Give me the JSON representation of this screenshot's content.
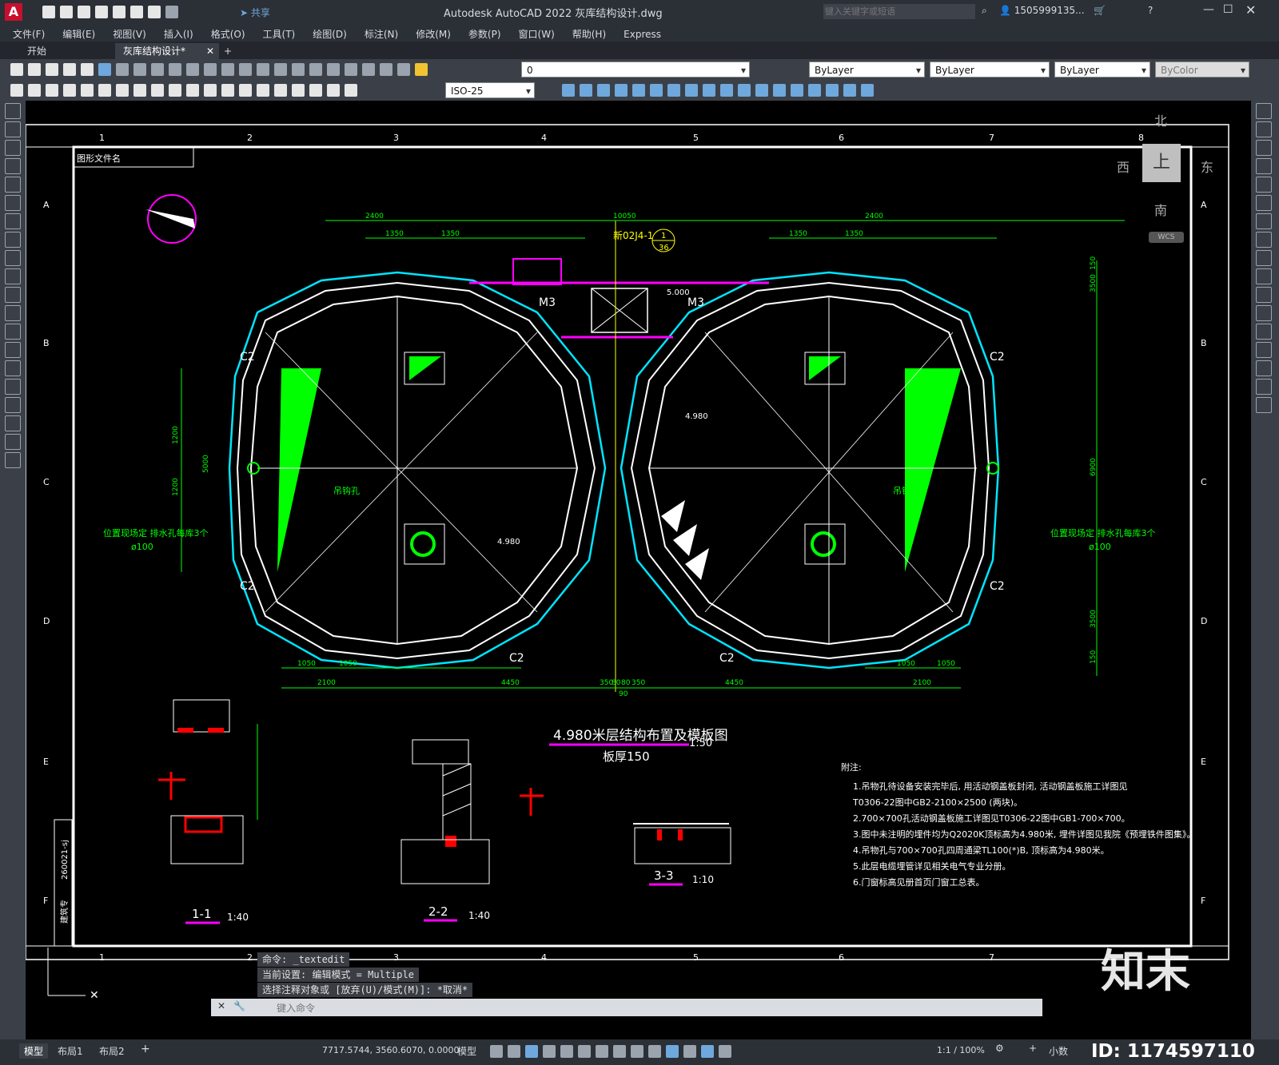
{
  "app": {
    "window_title": "Autodesk AutoCAD 2022    灰库结构设计.dwg",
    "share_label": "共享",
    "search_placeholder": "键入关键字或短语",
    "user": "1505999135...",
    "logo_letter": "A"
  },
  "menu": [
    "文件(F)",
    "编辑(E)",
    "视图(V)",
    "插入(I)",
    "格式(O)",
    "工具(T)",
    "绘图(D)",
    "标注(N)",
    "修改(M)",
    "参数(P)",
    "窗口(W)",
    "帮助(H)",
    "Express"
  ],
  "tabs": [
    {
      "label": "开始"
    },
    {
      "label": "灰库结构设计*"
    }
  ],
  "toolbar": {
    "layer_value": "0",
    "color_value": "ByLayer",
    "linetype_value": "ByLayer",
    "lineweight_value": "ByLayer",
    "plotstyle_value": "ByColor",
    "dimstyle_value": "ISO-25"
  },
  "viewcube": {
    "north": "北",
    "south": "南",
    "east": "东",
    "west": "西",
    "top": "上",
    "wcs": "WCS"
  },
  "drawing": {
    "title_block_label": "图形文件名",
    "main_title": "4.980米层结构布置及模板图",
    "main_scale": "1:50",
    "slab_thickness": "板厚150",
    "ref_label": "新02J4-1",
    "ref_num_top": "1",
    "ref_num_bottom": "36",
    "column_labels": [
      "1",
      "2",
      "3",
      "4",
      "5",
      "6",
      "7",
      "8"
    ],
    "row_labels": [
      "A",
      "B",
      "C",
      "D",
      "E",
      "F"
    ],
    "dims_top": [
      "2400",
      "10050",
      "2400"
    ],
    "dims_top2": [
      "1350",
      "1350",
      "1350",
      "1350"
    ],
    "dims_bottom": [
      "1050",
      "1050",
      "2100",
      "4450",
      "350",
      "80",
      "80",
      "350",
      "4450",
      "2100",
      "1050",
      "1050",
      "90"
    ],
    "dims_left": [
      "1200",
      "5000",
      "1200"
    ],
    "dims_right": [
      "150",
      "3500",
      "6900",
      "3500",
      "150"
    ],
    "labels_c2": [
      "C2",
      "C2",
      "C2",
      "C2",
      "C2",
      "C2"
    ],
    "labels_m3": [
      "M3",
      "M3"
    ],
    "drain_note": "位置现场定  排水孔每库3个",
    "drain_dia": "ø100",
    "hoist_hole": "吊钩孔",
    "elev_4980": "4.980",
    "elev_5000": "5.000",
    "section_1": "1-1",
    "section_1_scale": "1:40",
    "section_2": "2-2",
    "section_2_scale": "1:40",
    "section_3": "3-3",
    "section_3_scale": "1:10",
    "sheet_code": "260021-sj",
    "sheet_stamp": "建筑专",
    "notes_title": "附注:",
    "notes": [
      "1.吊物孔待设备安装完毕后, 用活动钢盖板封闭, 活动钢盖板施工详图见",
      "   T0306-22图中GB2-2100×2500 (两块)。",
      "2.700×700孔活动钢盖板施工详图见T0306-22图中GB1-700×700。",
      "3.图中未注明的埋件均为Q2020K顶标高为4.980米, 埋件详图见我院《预埋铁件图集》。",
      "4.吊物孔与700×700孔四周通梁TL100(*)B, 顶标高为4.980米。",
      "5.此层电缆埋管详见相关电气专业分册。",
      "6.门窗标高见册首页门窗工总表。"
    ]
  },
  "command": {
    "history": [
      "命令: _textedit",
      "当前设置: 编辑模式 = Multiple",
      "选择注释对象或 [放弃(U)/模式(M)]: *取消*"
    ],
    "prompt_placeholder": "键入命令"
  },
  "status": {
    "layout_tabs": [
      "模型",
      "布局1",
      "布局2"
    ],
    "coords": "7717.5744, 3560.6070, 0.0000",
    "model_label": "模型",
    "scale": "1:1 / 100%",
    "units": "小数"
  },
  "watermark": {
    "brand": "知末",
    "id": "ID: 1174597110"
  },
  "colors": {
    "green": "#00ff00",
    "cyan": "#00e5ff",
    "white": "#ffffff",
    "magenta": "#ff00ff",
    "yellow": "#ffff00",
    "red": "#ff0000"
  }
}
